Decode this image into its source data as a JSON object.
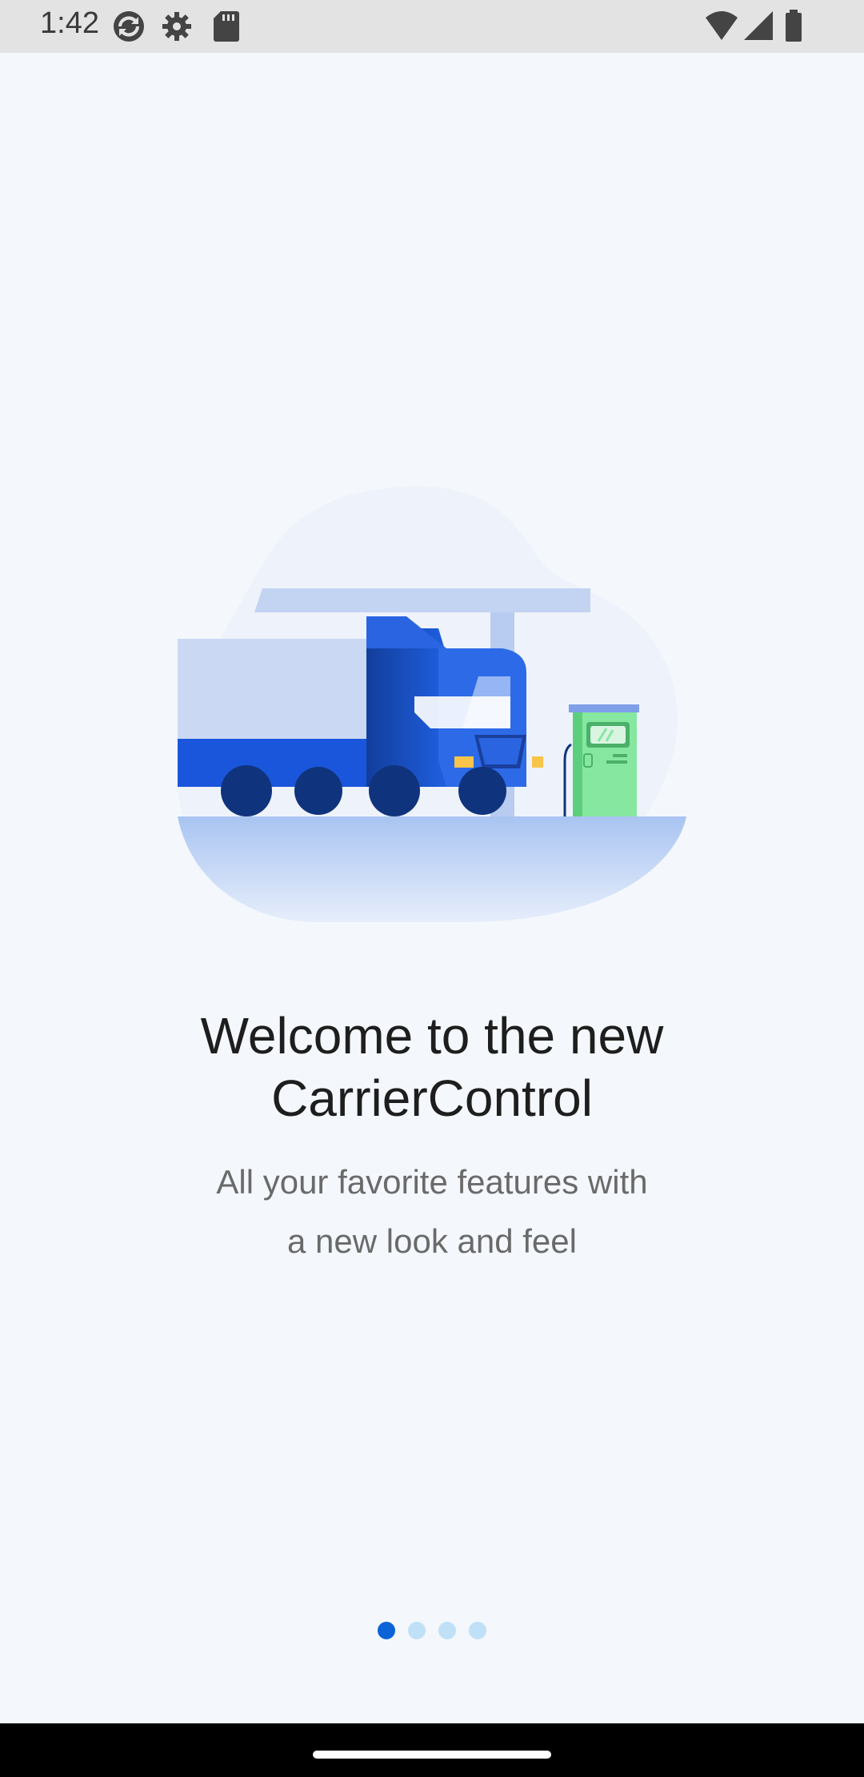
{
  "status_bar": {
    "time": "1:42",
    "icons_left": [
      "sync-icon",
      "settings-gear-icon",
      "sd-card-icon"
    ],
    "icons_right": [
      "wifi-icon",
      "cell-signal-icon",
      "battery-icon"
    ]
  },
  "onboarding": {
    "illustration": "truck-at-charging-station-illustration",
    "title_line1": "Welcome to the new",
    "title_line2": "CarrierControl",
    "subtitle_line1": "All your favorite features with",
    "subtitle_line2": "a new look and feel",
    "page_count": 4,
    "current_page": 1
  },
  "colors": {
    "background": "#f4f8fc",
    "title": "#1e1e1e",
    "subtitle": "#6a6a6a",
    "dot_active": "#0b63d8",
    "dot_inactive": "#bfe0f7",
    "truck_blue": "#1a56db",
    "pump_green": "#86e8a0"
  }
}
